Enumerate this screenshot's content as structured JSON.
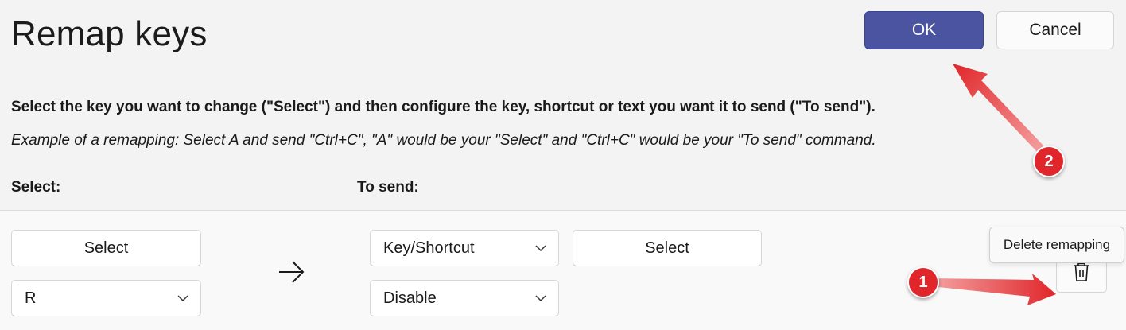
{
  "dialog": {
    "title": "Remap keys",
    "ok_label": "OK",
    "cancel_label": "Cancel",
    "instruction": "Select the key you want to change (\"Select\") and then configure the key, shortcut or text you want it to send (\"To send\").",
    "example": "Example of a remapping: Select A and send \"Ctrl+C\", \"A\" would be your \"Select\" and \"Ctrl+C\" would be your \"To send\" command."
  },
  "columns": {
    "select_label": "Select:",
    "send_label": "To send:"
  },
  "mapping_row": {
    "select_button_label": "Select",
    "select_key_value": "R",
    "send_type_value": "Key/Shortcut",
    "send_select_button_label": "Select",
    "send_key_value": "Disable",
    "delete_tooltip": "Delete remapping"
  },
  "annotations": {
    "badge_1": "1",
    "badge_2": "2",
    "color": "#e0262a"
  },
  "colors": {
    "accent": "#4a54a0",
    "background": "#f3f3f3"
  },
  "icons": [
    "right-arrow-icon",
    "chevron-down-icon",
    "trash-icon"
  ]
}
